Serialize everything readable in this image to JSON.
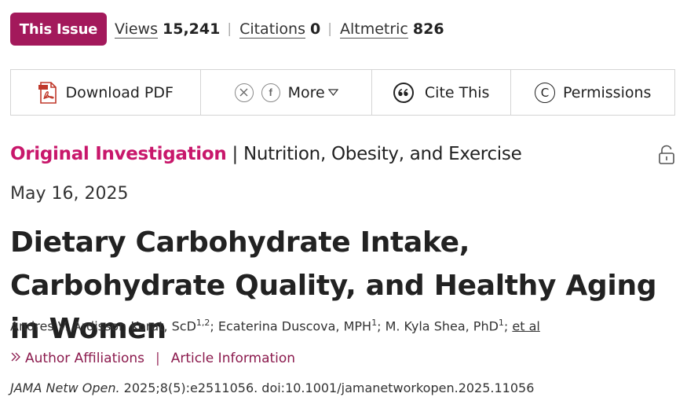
{
  "metrics": {
    "this_issue_label": "This Issue",
    "views_label": "Views",
    "views_value": "15,241",
    "citations_label": "Citations",
    "citations_value": "0",
    "altmetric_label": "Altmetric",
    "altmetric_value": "826",
    "separator": "|"
  },
  "toolbar": {
    "download_pdf_label": "Download PDF",
    "share_x_icon": "x-icon",
    "share_facebook_icon": "facebook-icon",
    "more_label": "More",
    "cite_label": "Cite This",
    "permissions_label": "Permissions"
  },
  "article": {
    "type": "Original Investigation",
    "section_separator": "|",
    "section": "Nutrition, Obesity, and Exercise",
    "date": "May 16, 2025",
    "title": "Dietary Carbohydrate Intake, Carbohydrate Quality, and Healthy Aging in Women",
    "authors": [
      {
        "name": "Andres V. Ardisson Korat, ScD",
        "sup": "1,2",
        "after": "; "
      },
      {
        "name": "Ecaterina Duscova, MPH",
        "sup": "1",
        "after": "; "
      },
      {
        "name": "M. Kyla Shea, PhD",
        "sup": "1",
        "after": "; "
      }
    ],
    "et_al": "et al",
    "author_affiliations_label": "Author Affiliations",
    "article_information_label": "Article Information",
    "link_divider": "|",
    "journal": "JAMA Netw Open.",
    "citation_details": "2025;8(5):e2511056. doi:10.1001/jamanetworkopen.2025.11056"
  },
  "colors": {
    "brand": "#a3195b",
    "article_type": "#c8176b",
    "link": "#8b1a4d"
  }
}
